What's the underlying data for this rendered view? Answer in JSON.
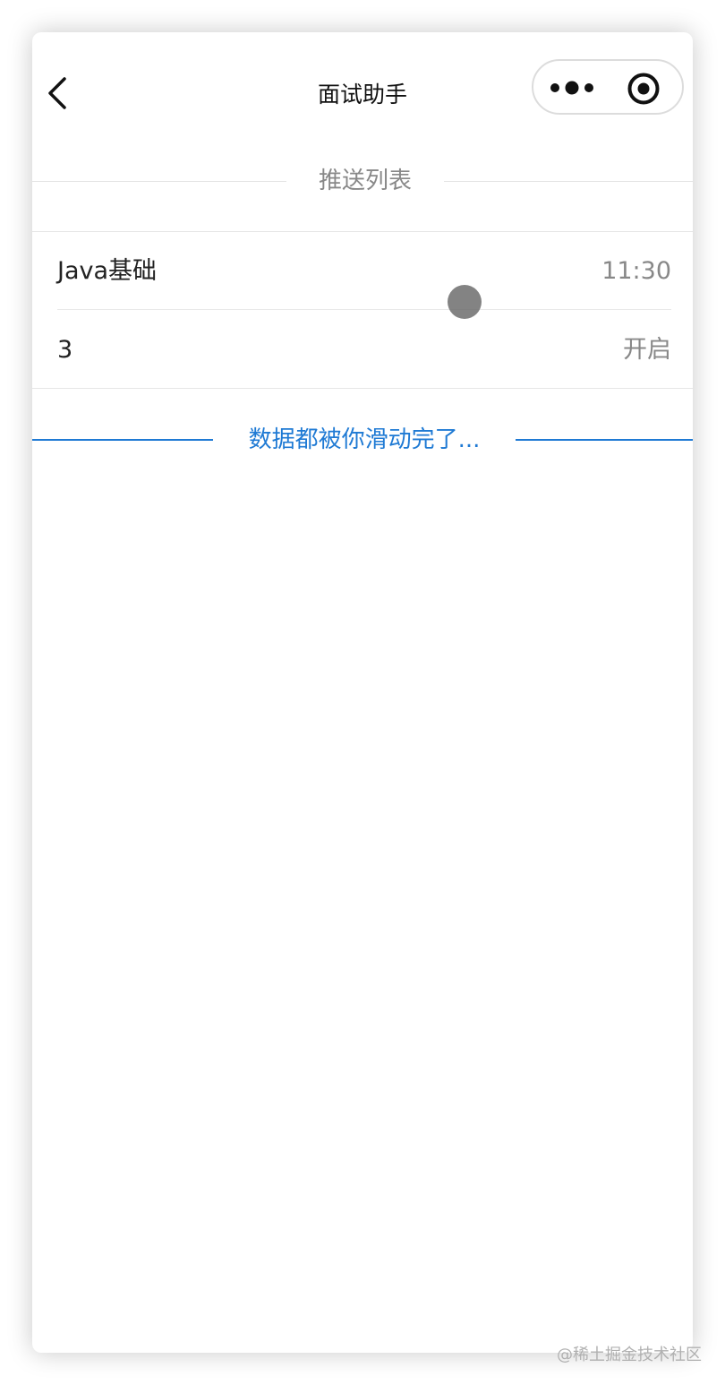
{
  "navbar": {
    "title": "面试助手",
    "back_icon": "chevron-left-icon",
    "more_icon": "more-dots-icon",
    "close_icon": "target-circle-icon"
  },
  "section": {
    "title": "推送列表"
  },
  "list": {
    "items": [
      {
        "left": "Java基础",
        "right": "11:30"
      },
      {
        "left": "3",
        "right": "开启"
      }
    ]
  },
  "footer": {
    "end_text": "数据都被你滑动完了...",
    "accent_color": "#1f7ad4"
  },
  "watermark": {
    "text": "@稀土掘金技术社区"
  }
}
